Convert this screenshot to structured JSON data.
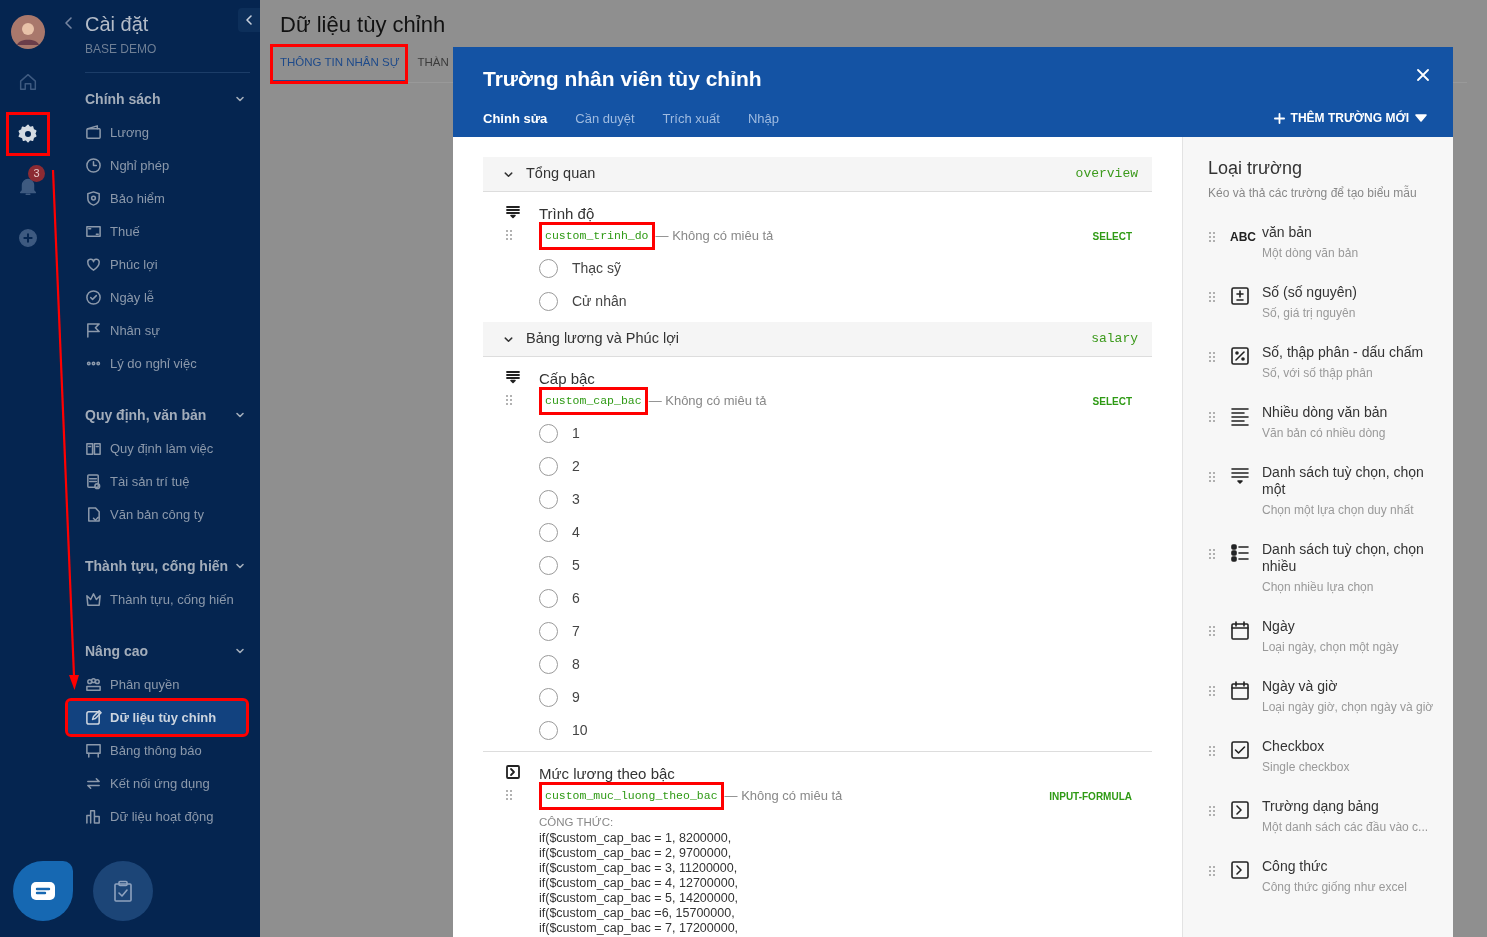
{
  "rail": {
    "items": [
      {
        "kind": "home",
        "selected": false,
        "annotated": false
      },
      {
        "kind": "settings",
        "selected": true,
        "annotated": true
      },
      {
        "kind": "bell",
        "selected": false,
        "annotated": false,
        "badge": "3"
      },
      {
        "kind": "add",
        "selected": false,
        "annotated": false
      }
    ]
  },
  "sidebar": {
    "title": "Cài đặt",
    "subtitle": "BASE DEMO",
    "groups": [
      {
        "title": "Chính sách",
        "expanded": true,
        "items": [
          {
            "label": "Lương",
            "selected": false,
            "annotated": false
          },
          {
            "label": "Nghỉ phép",
            "selected": false,
            "annotated": false
          },
          {
            "label": "Bảo hiểm",
            "selected": false,
            "annotated": false
          },
          {
            "label": "Thuế",
            "selected": false,
            "annotated": false
          },
          {
            "label": "Phúc lợi",
            "selected": false,
            "annotated": false
          },
          {
            "label": "Ngày lễ",
            "selected": false,
            "annotated": false
          },
          {
            "label": "Nhân sự",
            "selected": false,
            "annotated": false
          },
          {
            "label": "Lý do nghỉ việc",
            "selected": false,
            "annotated": false
          }
        ]
      },
      {
        "title": "Quy định, văn bản",
        "expanded": true,
        "items": [
          {
            "label": "Quy định làm việc",
            "selected": false,
            "annotated": false
          },
          {
            "label": "Tài sản trí tuệ",
            "selected": false,
            "annotated": false
          },
          {
            "label": "Văn bản công ty",
            "selected": false,
            "annotated": false
          }
        ]
      },
      {
        "title": "Thành tựu, cống hiến",
        "expanded": true,
        "items": [
          {
            "label": "Thành tựu, cống hiến",
            "selected": false,
            "annotated": false
          }
        ]
      },
      {
        "title": "Nâng cao",
        "expanded": true,
        "items": [
          {
            "label": "Phân quyền",
            "selected": false,
            "annotated": false
          },
          {
            "label": "Dữ liệu tùy chỉnh",
            "selected": true,
            "annotated": true
          },
          {
            "label": "Bảng thông báo",
            "selected": false,
            "annotated": false
          },
          {
            "label": "Kết nối ứng dụng",
            "selected": false,
            "annotated": false
          },
          {
            "label": "Dữ liệu hoạt động",
            "selected": false,
            "annotated": false
          }
        ]
      }
    ]
  },
  "page": {
    "title": "Dữ liệu tùy chỉnh",
    "tabs": [
      {
        "label": "THÔNG TIN NHÂN SỰ",
        "selected": true,
        "annotated": true
      },
      {
        "label": "THÀN",
        "selected": false,
        "annotated": false
      }
    ]
  },
  "modal": {
    "title": "Trường nhân viên tùy chỉnh",
    "tabs": [
      {
        "label": "Chỉnh sửa",
        "selected": true
      },
      {
        "label": "Cần duyệt",
        "selected": false
      },
      {
        "label": "Trích xuất",
        "selected": false
      },
      {
        "label": "Nhập",
        "selected": false
      }
    ],
    "add_button": "THÊM TRƯỜNG MỚI",
    "sections": [
      {
        "title": "Tổng quan",
        "key": "overview",
        "expanded": true,
        "fields": [
          {
            "kind": "select",
            "title": "Trình độ",
            "key": "custom_trinh_do",
            "key_annotated": true,
            "description": "— Không có miêu tả",
            "type": "SELECT",
            "options": [
              {
                "label": "Thạc sỹ",
                "selected": false
              },
              {
                "label": "Cử nhân",
                "selected": false
              }
            ]
          }
        ]
      },
      {
        "title": "Bảng lương và Phúc lợi",
        "key": "salary",
        "expanded": true,
        "fields": [
          {
            "kind": "select",
            "title": "Cấp bậc",
            "key": "custom_cap_bac",
            "key_annotated": true,
            "description": "— Không có miêu tả",
            "type": "SELECT",
            "options": [
              {
                "label": "1",
                "selected": false
              },
              {
                "label": "2",
                "selected": false
              },
              {
                "label": "3",
                "selected": false
              },
              {
                "label": "4",
                "selected": false
              },
              {
                "label": "5",
                "selected": false
              },
              {
                "label": "6",
                "selected": false
              },
              {
                "label": "7",
                "selected": false
              },
              {
                "label": "8",
                "selected": false
              },
              {
                "label": "9",
                "selected": false
              },
              {
                "label": "10",
                "selected": false
              }
            ]
          },
          {
            "kind": "formula",
            "title": "Mức lương theo bậc",
            "key": "custom_muc_luong_theo_bac",
            "key_annotated": true,
            "description": "— Không có miêu tả",
            "type": "INPUT-FORMULA",
            "formula_label": "CÔNG THỨC:",
            "formula_lines": [
              "if($custom_cap_bac = 1, 8200000,",
              "if($custom_cap_bac = 2, 9700000,",
              "if($custom_cap_bac = 3, 11200000,",
              "if($custom_cap_bac = 4, 12700000,",
              "if($custom_cap_bac = 5, 14200000,",
              "if($custom_cap_bac =6, 15700000,",
              "if($custom_cap_bac = 7, 17200000,"
            ]
          }
        ]
      }
    ]
  },
  "field_types": {
    "title": "Loại trường",
    "subtitle": "Kéo và thả các trường để tạo biểu mẫu",
    "items": [
      {
        "kind": "text",
        "icon_text": "ABC",
        "title": "văn bản",
        "subtitle": "Một dòng văn bản"
      },
      {
        "kind": "integer",
        "title": "Số (số nguyên)",
        "subtitle": "Số, giá trị nguyên"
      },
      {
        "kind": "decimal",
        "title": "Số, thập phân - dấu chấm",
        "subtitle": "Số, với số thập phân"
      },
      {
        "kind": "multiline",
        "title": "Nhiều dòng văn bản",
        "subtitle": "Văn bản có nhiều dòng"
      },
      {
        "kind": "select",
        "title": "Danh sách tuỳ chọn, chọn một",
        "subtitle": "Chọn một lựa chọn duy nhất"
      },
      {
        "kind": "multiselect",
        "title": "Danh sách tuỳ chọn, chọn nhiều",
        "subtitle": "Chọn nhiều lựa chọn"
      },
      {
        "kind": "date",
        "title": "Ngày",
        "subtitle": "Loại ngày, chọn một ngày"
      },
      {
        "kind": "datetime",
        "title": "Ngày và giờ",
        "subtitle": "Loại ngày giờ, chọn ngày và giờ"
      },
      {
        "kind": "checkbox",
        "title": "Checkbox",
        "subtitle": "Single checkbox"
      },
      {
        "kind": "table",
        "title": "Trường dạng bảng",
        "subtitle": "Một danh sách các đầu vào c..."
      },
      {
        "kind": "formula",
        "title": "Công thức",
        "subtitle": "Công thức giống như excel"
      }
    ]
  }
}
